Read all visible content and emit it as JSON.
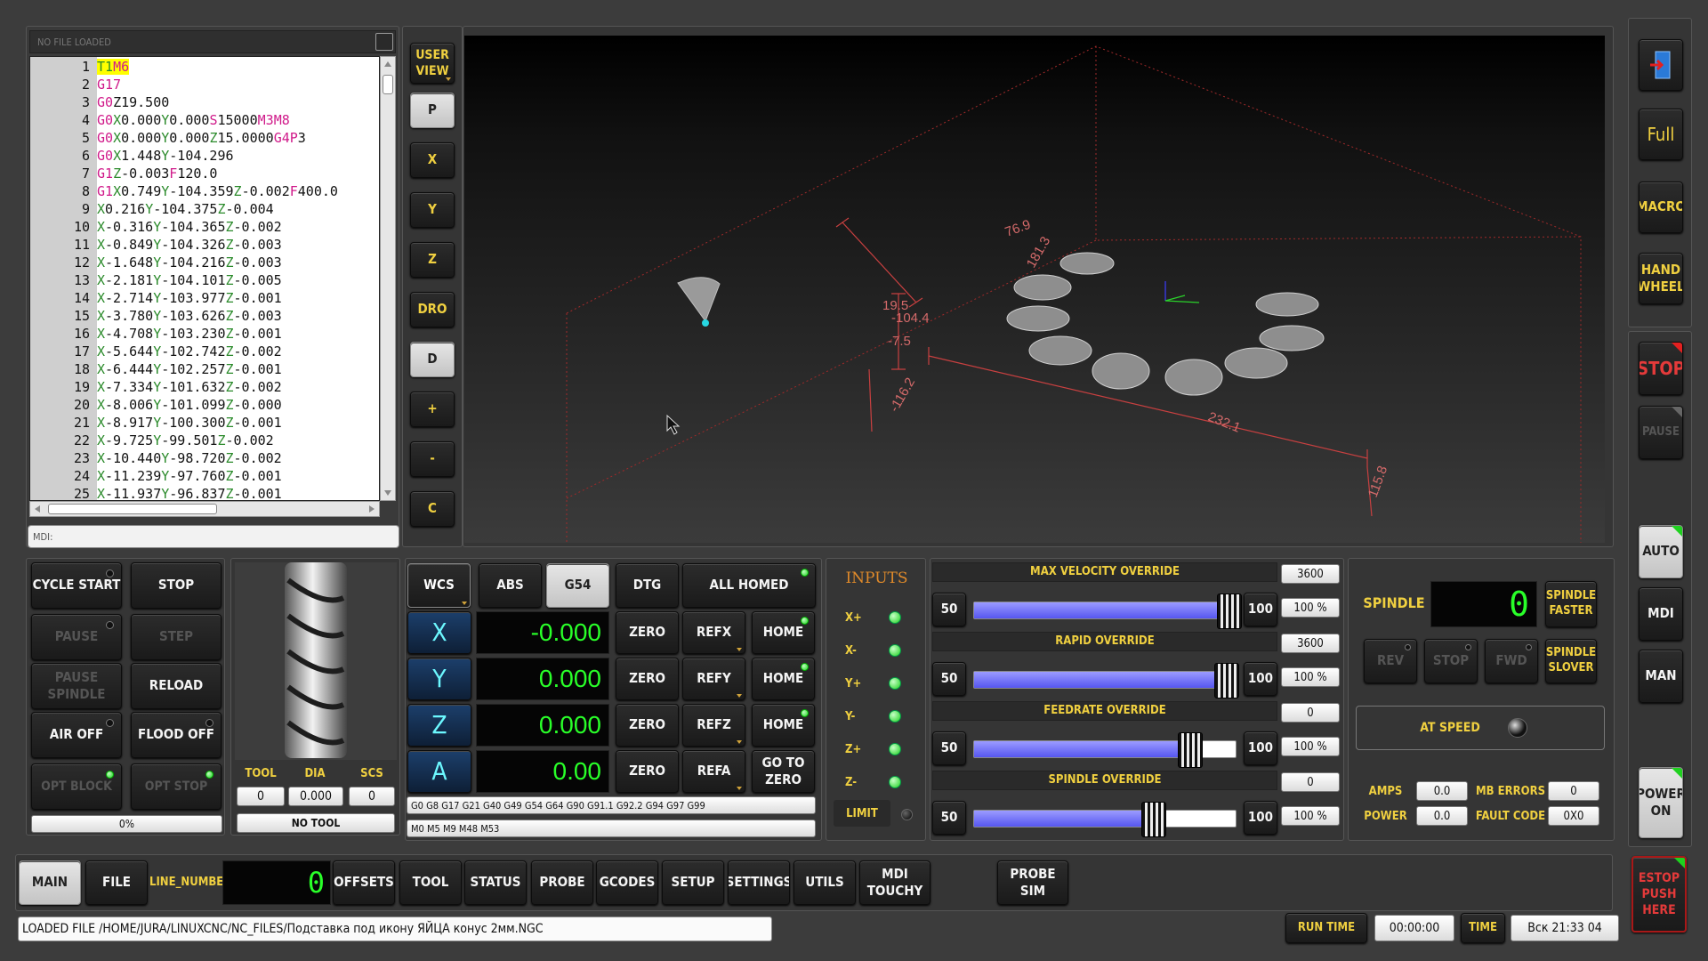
{
  "gcode_editor": {
    "file_status": "NO FILE LOADED",
    "lines": [
      {
        "n": "1",
        "t": [
          [
            "T1",
            "kw"
          ],
          [
            "M6",
            "kf"
          ]
        ]
      },
      {
        "n": "2",
        "t": [
          [
            "G17",
            "kf"
          ]
        ]
      },
      {
        "n": "3",
        "t": [
          [
            "G0",
            "kf"
          ],
          [
            "Z19.500",
            ""
          ]
        ]
      },
      {
        "n": "4",
        "t": [
          [
            "G0",
            "kf"
          ],
          [
            "X",
            "kw"
          ],
          [
            "0.000",
            ""
          ],
          [
            "Y",
            "kw"
          ],
          [
            "0.000",
            ""
          ],
          [
            "S",
            "kf"
          ],
          [
            "15000",
            ""
          ],
          [
            "M3",
            "kf"
          ],
          [
            "M8",
            "kf"
          ]
        ]
      },
      {
        "n": "5",
        "t": [
          [
            "G0",
            "kf"
          ],
          [
            "X",
            "kw"
          ],
          [
            "0.000",
            ""
          ],
          [
            "Y",
            "kw"
          ],
          [
            "0.000",
            ""
          ],
          [
            "Z",
            "kw"
          ],
          [
            "15.0000",
            ""
          ],
          [
            "G4",
            "kf"
          ],
          [
            "P",
            "kf"
          ],
          [
            "3",
            ""
          ]
        ]
      },
      {
        "n": "6",
        "t": [
          [
            "G0",
            "kf"
          ],
          [
            "X",
            "kw"
          ],
          [
            "1.448",
            ""
          ],
          [
            "Y",
            "kw"
          ],
          [
            "-104.296",
            ""
          ]
        ]
      },
      {
        "n": "7",
        "t": [
          [
            "G1",
            "kf"
          ],
          [
            "Z",
            "kw"
          ],
          [
            "-0.003",
            ""
          ],
          [
            "F",
            "kf"
          ],
          [
            "120.0",
            ""
          ]
        ]
      },
      {
        "n": "8",
        "t": [
          [
            "G1",
            "kf"
          ],
          [
            "X",
            "kw"
          ],
          [
            "0.749",
            ""
          ],
          [
            "Y",
            "kw"
          ],
          [
            "-104.359",
            ""
          ],
          [
            "Z",
            "kw"
          ],
          [
            "-0.002",
            ""
          ],
          [
            "F",
            "kf"
          ],
          [
            "400.0",
            ""
          ]
        ]
      },
      {
        "n": "9",
        "t": [
          [
            "X",
            "kw"
          ],
          [
            "0.216",
            ""
          ],
          [
            "Y",
            "kw"
          ],
          [
            "-104.375",
            ""
          ],
          [
            "Z",
            "kw"
          ],
          [
            "-0.004",
            ""
          ]
        ]
      },
      {
        "n": "10",
        "t": [
          [
            "X",
            "kw"
          ],
          [
            "-0.316",
            ""
          ],
          [
            "Y",
            "kw"
          ],
          [
            "-104.365",
            ""
          ],
          [
            "Z",
            "kw"
          ],
          [
            "-0.002",
            ""
          ]
        ]
      },
      {
        "n": "11",
        "t": [
          [
            "X",
            "kw"
          ],
          [
            "-0.849",
            ""
          ],
          [
            "Y",
            "kw"
          ],
          [
            "-104.326",
            ""
          ],
          [
            "Z",
            "kw"
          ],
          [
            "-0.003",
            ""
          ]
        ]
      },
      {
        "n": "12",
        "t": [
          [
            "X",
            "kw"
          ],
          [
            "-1.648",
            ""
          ],
          [
            "Y",
            "kw"
          ],
          [
            "-104.216",
            ""
          ],
          [
            "Z",
            "kw"
          ],
          [
            "-0.003",
            ""
          ]
        ]
      },
      {
        "n": "13",
        "t": [
          [
            "X",
            "kw"
          ],
          [
            "-2.181",
            ""
          ],
          [
            "Y",
            "kw"
          ],
          [
            "-104.101",
            ""
          ],
          [
            "Z",
            "kw"
          ],
          [
            "-0.005",
            ""
          ]
        ]
      },
      {
        "n": "14",
        "t": [
          [
            "X",
            "kw"
          ],
          [
            "-2.714",
            ""
          ],
          [
            "Y",
            "kw"
          ],
          [
            "-103.977",
            ""
          ],
          [
            "Z",
            "kw"
          ],
          [
            "-0.001",
            ""
          ]
        ]
      },
      {
        "n": "15",
        "t": [
          [
            "X",
            "kw"
          ],
          [
            "-3.780",
            ""
          ],
          [
            "Y",
            "kw"
          ],
          [
            "-103.626",
            ""
          ],
          [
            "Z",
            "kw"
          ],
          [
            "-0.003",
            ""
          ]
        ]
      },
      {
        "n": "16",
        "t": [
          [
            "X",
            "kw"
          ],
          [
            "-4.708",
            ""
          ],
          [
            "Y",
            "kw"
          ],
          [
            "-103.230",
            ""
          ],
          [
            "Z",
            "kw"
          ],
          [
            "-0.001",
            ""
          ]
        ]
      },
      {
        "n": "17",
        "t": [
          [
            "X",
            "kw"
          ],
          [
            "-5.644",
            ""
          ],
          [
            "Y",
            "kw"
          ],
          [
            "-102.742",
            ""
          ],
          [
            "Z",
            "kw"
          ],
          [
            "-0.002",
            ""
          ]
        ]
      },
      {
        "n": "18",
        "t": [
          [
            "X",
            "kw"
          ],
          [
            "-6.444",
            ""
          ],
          [
            "Y",
            "kw"
          ],
          [
            "-102.257",
            ""
          ],
          [
            "Z",
            "kw"
          ],
          [
            "-0.001",
            ""
          ]
        ]
      },
      {
        "n": "19",
        "t": [
          [
            "X",
            "kw"
          ],
          [
            "-7.334",
            ""
          ],
          [
            "Y",
            "kw"
          ],
          [
            "-101.632",
            ""
          ],
          [
            "Z",
            "kw"
          ],
          [
            "-0.002",
            ""
          ]
        ]
      },
      {
        "n": "20",
        "t": [
          [
            "X",
            "kw"
          ],
          [
            "-8.006",
            ""
          ],
          [
            "Y",
            "kw"
          ],
          [
            "-101.099",
            ""
          ],
          [
            "Z",
            "kw"
          ],
          [
            "-0.000",
            ""
          ]
        ]
      },
      {
        "n": "21",
        "t": [
          [
            "X",
            "kw"
          ],
          [
            "-8.917",
            ""
          ],
          [
            "Y",
            "kw"
          ],
          [
            "-100.300",
            ""
          ],
          [
            "Z",
            "kw"
          ],
          [
            "-0.001",
            ""
          ]
        ]
      },
      {
        "n": "22",
        "t": [
          [
            "X",
            "kw"
          ],
          [
            "-9.725",
            ""
          ],
          [
            "Y",
            "kw"
          ],
          [
            "-99.501",
            ""
          ],
          [
            "Z",
            "kw"
          ],
          [
            "-0.002",
            ""
          ]
        ]
      },
      {
        "n": "23",
        "t": [
          [
            "X",
            "kw"
          ],
          [
            "-10.440",
            ""
          ],
          [
            "Y",
            "kw"
          ],
          [
            "-98.720",
            ""
          ],
          [
            "Z",
            "kw"
          ],
          [
            "-0.002",
            ""
          ]
        ]
      },
      {
        "n": "24",
        "t": [
          [
            "X",
            "kw"
          ],
          [
            "-11.239",
            ""
          ],
          [
            "Y",
            "kw"
          ],
          [
            "-97.760",
            ""
          ],
          [
            "Z",
            "kw"
          ],
          [
            "-0.001",
            ""
          ]
        ]
      },
      {
        "n": "25",
        "t": [
          [
            "X",
            "kw"
          ],
          [
            "-11.937",
            ""
          ],
          [
            "Y",
            "kw"
          ],
          [
            "-96.837",
            ""
          ],
          [
            "Z",
            "kw"
          ],
          [
            "-0.001",
            ""
          ]
        ]
      }
    ],
    "mdi_placeholder": "MDI:"
  },
  "view_buttons": {
    "user_view": "USER VIEW",
    "p": "P",
    "x": "X",
    "y": "Y",
    "z": "Z",
    "dro": "DRO",
    "d": "D",
    "plus": "+",
    "minus": "-",
    "c": "C"
  },
  "preview": {
    "dims": [
      "76.9",
      "181.3",
      "19.5",
      "-104.4",
      "-7.5",
      "-116.2",
      "232.1",
      "115.8"
    ]
  },
  "right_sidebar": {
    "full": "Full",
    "macro": "MACRO",
    "handwheel": "HAND WHEEL",
    "stop": "STOP",
    "pause": "PAUSE",
    "auto": "AUTO",
    "mdi": "MDI",
    "man": "MAN",
    "power_on": "POWER ON",
    "estop": "ESTOP PUSH HERE",
    "exit_icon": "exit-icon"
  },
  "controls": {
    "cycle_start": "CYCLE START",
    "stop": "STOP",
    "pause": "PAUSE",
    "step": "STEP",
    "pause_spindle": "PAUSE SPINDLE",
    "reload": "RELOAD",
    "air_off": "AIR OFF",
    "flood_off": "FLOOD OFF",
    "opt_block": "OPT BLOCK",
    "opt_stop": "OPT STOP",
    "progress": "0%"
  },
  "tool": {
    "tool_label": "TOOL",
    "dia_label": "DIA",
    "scs_label": "SCS",
    "tool": "0",
    "dia": "0.000",
    "scs": "0",
    "name": "NO TOOL"
  },
  "dro": {
    "wcs": "WCS",
    "abs": "ABS",
    "g54": "G54",
    "dtg": "DTG",
    "all_homed": "ALL HOMED",
    "zero": "ZERO",
    "home": "HOME",
    "goto_zero": "GO TO ZERO",
    "axes": [
      {
        "name": "X",
        "value": "-0.000",
        "ref": "REFX"
      },
      {
        "name": "Y",
        "value": "0.000",
        "ref": "REFY"
      },
      {
        "name": "Z",
        "value": "0.000",
        "ref": "REFZ"
      },
      {
        "name": "A",
        "value": "0.00",
        "ref": "REFA"
      }
    ],
    "gcodes": "G0 G8 G17 G21 G40 G49 G54 G64 G90 G91.1 G92.2 G94 G97 G99",
    "mcodes": "M0 M5 M9 M48 M53"
  },
  "inputs": {
    "title": "INPUTS",
    "items": [
      "X+",
      "X-",
      "Y+",
      "Y-",
      "Z+",
      "Z-"
    ],
    "limit": "LIMIT"
  },
  "overrides": [
    {
      "title": "MAX VELOCITY OVERRIDE",
      "value": "3600",
      "percent": "100 %",
      "level": 0.95
    },
    {
      "title": "RAPID OVERRIDE",
      "value": "3600",
      "percent": "100 %",
      "level": 0.94
    },
    {
      "title": "FEEDRATE OVERRIDE",
      "value": "0",
      "percent": "100 %",
      "level": 0.8
    },
    {
      "title": "SPINDLE OVERRIDE",
      "value": "0",
      "percent": "100 %",
      "level": 0.66
    }
  ],
  "override_labels": {
    "min": "50",
    "max": "100"
  },
  "spindle": {
    "title": "SPINDLE",
    "rpm": "0",
    "faster": "SPINDLE FASTER",
    "slower": "SPINDLE SLOVER",
    "rev": "REV",
    "stop": "STOP",
    "fwd": "FWD",
    "at_speed": "AT SPEED",
    "amps_label": "AMPS",
    "amps": "0.0",
    "mb_errors_label": "MB ERRORS",
    "mb_errors": "0",
    "power_label": "POWER",
    "power": "0.0",
    "fault_label": "FAULT CODE",
    "fault": "0X0"
  },
  "tabs": {
    "main": "MAIN",
    "file": "FILE",
    "line_number": "LINE_NUMBER",
    "line_value": "0",
    "offsets": "OFFSETS",
    "tool": "TOOL",
    "status": "STATUS",
    "probe": "PROBE",
    "gcodes": "GCODES",
    "setup": "SETUP",
    "settings": "SETTINGS",
    "utils": "UTILS",
    "mdi_touchy": "MDI TOUCHY",
    "probe_sim": "PROBE SIM"
  },
  "status": {
    "loaded_file": "LOADED FILE /HOME/JURA/LINUXCNC/NC_FILES/Подставка под икону ЯЙЦА конус 2мм.NGC",
    "run_time_label": "RUN TIME",
    "run_time": "00:00:00",
    "time_label": "TIME",
    "time": "Вск 21:33 04"
  },
  "colors": {
    "accent_yellow": "#f0d040",
    "led_green": "#1fd11f",
    "stop_red": "#e43a3a",
    "preview_red": "#c84040"
  }
}
